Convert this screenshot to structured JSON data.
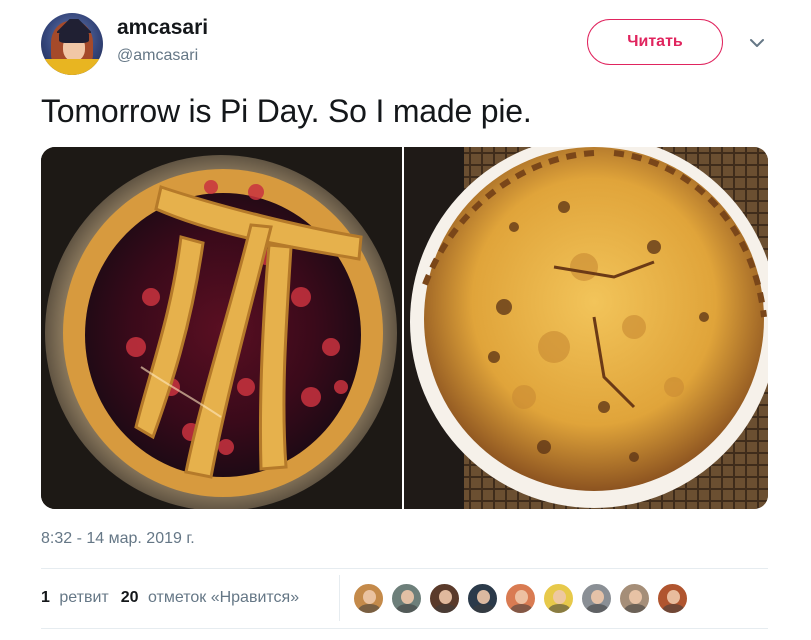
{
  "author": {
    "display_name": "amcasari",
    "handle": "@amcasari",
    "avatar_icon": "avatar-image"
  },
  "follow_button": {
    "label": "Читать",
    "color": "#e0245e"
  },
  "menu_icon": "chevron-down-icon",
  "tweet": {
    "text": "Tomorrow is Pi Day. So I made pie.",
    "photos": [
      {
        "icon": "cherry-pie-photo"
      },
      {
        "icon": "pot-pie-photo"
      }
    ],
    "timestamp": "8:32 - 14 мар. 2019 г."
  },
  "stats": {
    "retweets": {
      "count": "1",
      "label": "ретвит"
    },
    "likes": {
      "count": "20",
      "label": "отметок «Нравится»"
    }
  },
  "likers": [
    {
      "color": "#c48a4a"
    },
    {
      "color": "#6d7f7a"
    },
    {
      "color": "#5a3a2a"
    },
    {
      "color": "#2b3a4a"
    },
    {
      "color": "#d97b52"
    },
    {
      "color": "#e7c94a"
    },
    {
      "color": "#8a8f95"
    },
    {
      "color": "#a58e78"
    },
    {
      "color": "#b0552f"
    }
  ],
  "colors": {
    "text": "#14171a",
    "secondary": "#657786",
    "divider": "#e6ecf0",
    "accent": "#e0245e"
  }
}
